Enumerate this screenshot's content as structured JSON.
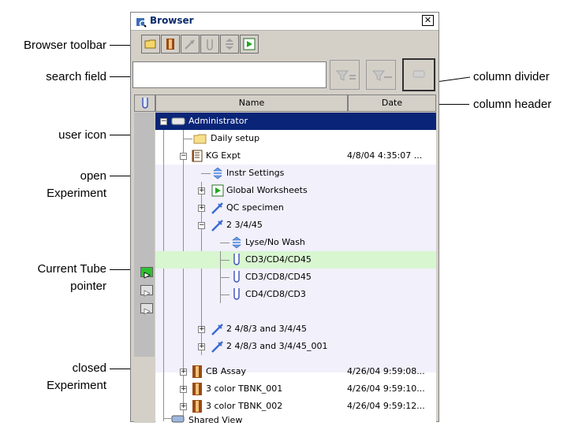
{
  "window": {
    "title": "Browser",
    "close_glyph": "✕"
  },
  "toolbar": {
    "buttons": [
      {
        "icon": "folder-icon",
        "enabled": true
      },
      {
        "icon": "experiment-icon",
        "enabled": true
      },
      {
        "icon": "specimen-icon",
        "enabled": false
      },
      {
        "icon": "tube-icon",
        "enabled": false
      },
      {
        "icon": "instrument-settings-icon",
        "enabled": false
      },
      {
        "icon": "worksheet-icon",
        "enabled": true
      }
    ]
  },
  "search": {
    "value": ""
  },
  "columns": {
    "tube_header_icon": "tube-icon",
    "name": "Name",
    "date": "Date"
  },
  "tree": {
    "rows": [
      {
        "label": "Administrator",
        "date": "",
        "icon": "user-icon"
      },
      {
        "label": "Daily setup",
        "date": "",
        "icon": "folder-icon"
      },
      {
        "label": "KG Expt",
        "date": "4/8/04 4:35:07 ...",
        "icon": "open-experiment-icon"
      },
      {
        "label": "Instr Settings",
        "date": "",
        "icon": "instrument-settings-icon"
      },
      {
        "label": "Global Worksheets",
        "date": "",
        "icon": "worksheet-icon"
      },
      {
        "label": "QC specimen",
        "date": "",
        "icon": "specimen-icon"
      },
      {
        "label": "2 3/4/45",
        "date": "",
        "icon": "specimen-icon"
      },
      {
        "label": "Lyse/No Wash",
        "date": "",
        "icon": "instrument-settings-icon"
      },
      {
        "label": "CD3/CD4/CD45",
        "date": "",
        "icon": "tube-icon"
      },
      {
        "label": "CD3/CD8/CD45",
        "date": "",
        "icon": "tube-icon"
      },
      {
        "label": "CD4/CD8/CD3",
        "date": "",
        "icon": "tube-icon"
      },
      {
        "label": "2 4/8/3 and 3/4/45",
        "date": "",
        "icon": "specimen-icon"
      },
      {
        "label": "2 4/8/3 and 3/4/45_001",
        "date": "",
        "icon": "specimen-icon"
      },
      {
        "label": "CB Assay",
        "date": "4/26/04 9:59:08...",
        "icon": "closed-experiment-icon"
      },
      {
        "label": "3 color TBNK_001",
        "date": "4/26/04 9:59:10...",
        "icon": "closed-experiment-icon"
      },
      {
        "label": "3 color TBNK_002",
        "date": "4/26/04 9:59:12...",
        "icon": "closed-experiment-icon"
      },
      {
        "label": "Shared View",
        "date": "",
        "icon": "shared-view-icon"
      }
    ]
  },
  "callouts": {
    "browser_toolbar": "Browser toolbar",
    "search_field": "search field",
    "user_icon": "user icon",
    "open_experiment_1": "open",
    "open_experiment_2": "Experiment",
    "current_tube_1": "Current Tube",
    "current_tube_2": "pointer",
    "closed_experiment_1": "closed",
    "closed_experiment_2": "Experiment",
    "column_divider": "column divider",
    "column_header": "column header"
  },
  "colors": {
    "selection": "#0a2578",
    "current_row": "#d8f6d0",
    "pointer_active": "#2ec02e",
    "experiment_brown": "#9a4a12"
  }
}
